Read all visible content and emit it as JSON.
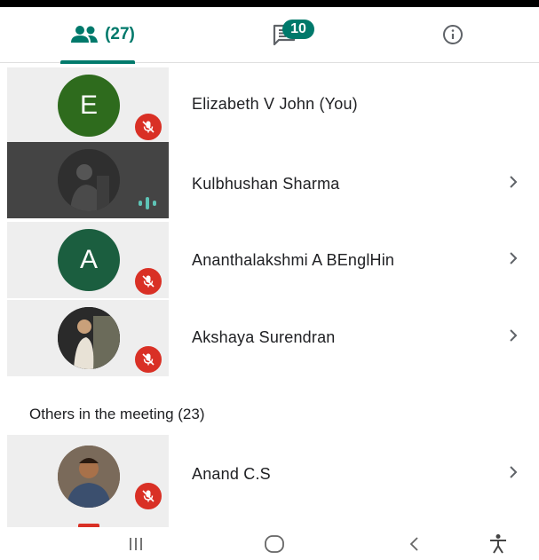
{
  "tabs": {
    "people_count": "(27)",
    "chat_badge": "10"
  },
  "participants": [
    {
      "name": "Elizabeth V John (You)",
      "initial": "E",
      "avatar_color": "#2e6b1d",
      "mic": "muted"
    },
    {
      "name": "Kulbhushan Sharma",
      "initial": "",
      "avatar_color": "#3a3a3a",
      "mic": "speaking"
    },
    {
      "name": "Ananthalakshmi A BEnglHin",
      "initial": "A",
      "avatar_color": "#1b5e3f",
      "mic": "muted"
    },
    {
      "name": "Akshaya Surendran",
      "initial": "",
      "avatar_color": "#5a4a3a",
      "mic": "muted"
    }
  ],
  "others": {
    "title": "Others in the meeting (23)",
    "participants": [
      {
        "name": "Anand C.S",
        "initial": "",
        "avatar_color": "#6b4a30",
        "mic": "muted"
      }
    ]
  },
  "colors": {
    "accent": "#00796b",
    "muted_red": "#d93025"
  },
  "nav": {
    "recent": "recents-icon",
    "home": "home-icon",
    "back": "back-icon",
    "accessibility": "accessibility-icon"
  }
}
